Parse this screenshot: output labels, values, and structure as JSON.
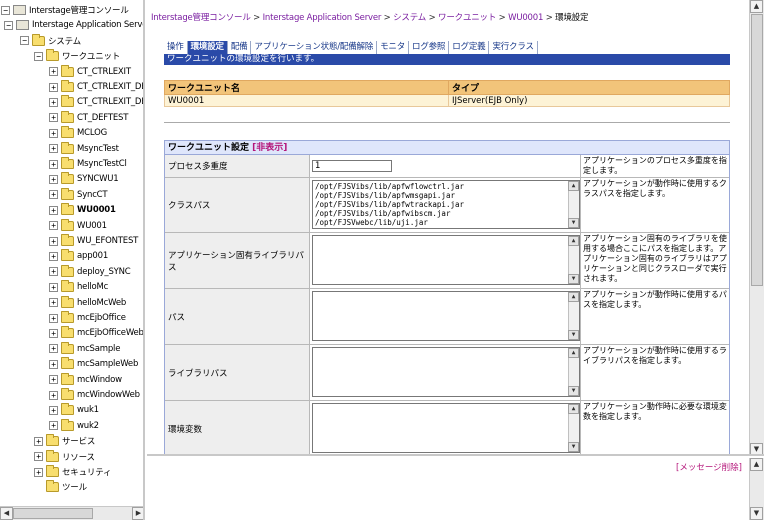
{
  "tree": {
    "root_label": "Interstage管理コンソール",
    "server_label": "Interstage Application Server",
    "system_label": "システム",
    "workunit_label": "ワークユニット",
    "workunits": [
      {
        "label": "CT_CTRLEXIT",
        "bold": false
      },
      {
        "label": "CT_CTRLEXIT_DB",
        "bold": false
      },
      {
        "label": "CT_CTRLEXIT_DB",
        "bold": false
      },
      {
        "label": "CT_DEFTEST",
        "bold": false
      },
      {
        "label": "MCLOG",
        "bold": false
      },
      {
        "label": "MsyncTest",
        "bold": false
      },
      {
        "label": "MsyncTestCl",
        "bold": false
      },
      {
        "label": "SYNCWU1",
        "bold": false
      },
      {
        "label": "SyncCT",
        "bold": false
      },
      {
        "label": "WU0001",
        "bold": true
      },
      {
        "label": "WU001",
        "bold": false
      },
      {
        "label": "WU_EFONTEST",
        "bold": false
      },
      {
        "label": "app001",
        "bold": false
      },
      {
        "label": "deploy_SYNC",
        "bold": false
      },
      {
        "label": "helloMc",
        "bold": false
      },
      {
        "label": "helloMcWeb",
        "bold": false
      },
      {
        "label": "mcEjbOffice",
        "bold": false
      },
      {
        "label": "mcEjbOfficeWeb",
        "bold": false
      },
      {
        "label": "mcSample",
        "bold": false
      },
      {
        "label": "mcSampleWeb",
        "bold": false
      },
      {
        "label": "mcWindow",
        "bold": false
      },
      {
        "label": "mcWindowWeb",
        "bold": false
      },
      {
        "label": "wuk1",
        "bold": false
      },
      {
        "label": "wuk2",
        "bold": false
      }
    ],
    "service_label": "サービス",
    "resource_label": "リソース",
    "security_label": "セキュリティ",
    "tools_label": "ツール"
  },
  "breadcrumb": {
    "items": [
      "Interstage管理コンソール",
      "Interstage Application Server",
      "システム",
      "ワークユニット",
      "WU0001",
      "環境設定"
    ],
    "separator": ">"
  },
  "tabs": [
    {
      "label": "操作",
      "active": false
    },
    {
      "label": "環境設定",
      "active": true
    },
    {
      "label": "配備",
      "active": false
    },
    {
      "label": "アプリケーション状態/配備解除",
      "active": false
    },
    {
      "label": "モニタ",
      "active": false
    },
    {
      "label": "ログ参照",
      "active": false
    },
    {
      "label": "ログ定義",
      "active": false
    },
    {
      "label": "実行クラス",
      "active": false
    }
  ],
  "tab_description": "ワークユニットの環境設定を行います。",
  "unit_table": {
    "headers": [
      "ワークユニット名",
      "タイプ"
    ],
    "row": [
      "WU0001",
      "IJServer(EJB Only)"
    ]
  },
  "settings": {
    "title": "ワークユニット設定",
    "toggle_label": "[非表示]",
    "rows": [
      {
        "label": "プロセス多重度",
        "kind": "text",
        "value": "1",
        "desc": "アプリケーションのプロセス多重度を指定します。"
      },
      {
        "label": "クラスパス",
        "kind": "area",
        "lines": [
          "/opt/FJSVibs/lib/apfwflowctrl.jar",
          "/opt/FJSVibs/lib/apfwmsgapi.jar",
          "/opt/FJSVibs/lib/apfwtrackapi.jar",
          "/opt/FJSVibs/lib/apfwibscm.jar",
          "/opt/FJSVwebc/lib/uji.jar"
        ],
        "desc": "アプリケーションが動作時に使用するクラスパスを指定します。"
      },
      {
        "label": "アプリケーション固有ライブラリパス",
        "kind": "area",
        "lines": [],
        "desc": "アプリケーション固有のライブラリを使用する場合ここにパスを指定します。アプリケーション固有のライブラリはアプリケーションと同じクラスローダで実行されます。"
      },
      {
        "label": "パス",
        "kind": "area",
        "lines": [],
        "desc": "アプリケーションが動作時に使用するパスを指定します。"
      },
      {
        "label": "ライブラリパス",
        "kind": "area",
        "lines": [],
        "desc": "アプリケーションが動作時に使用するライブラリパスを指定します。"
      },
      {
        "label": "環境変数",
        "kind": "area",
        "lines": [],
        "desc": "アプリケーション動作時に必要な環境変数を指定します。"
      }
    ]
  },
  "messages": {
    "delete_label": "[メッセージ削除]"
  }
}
